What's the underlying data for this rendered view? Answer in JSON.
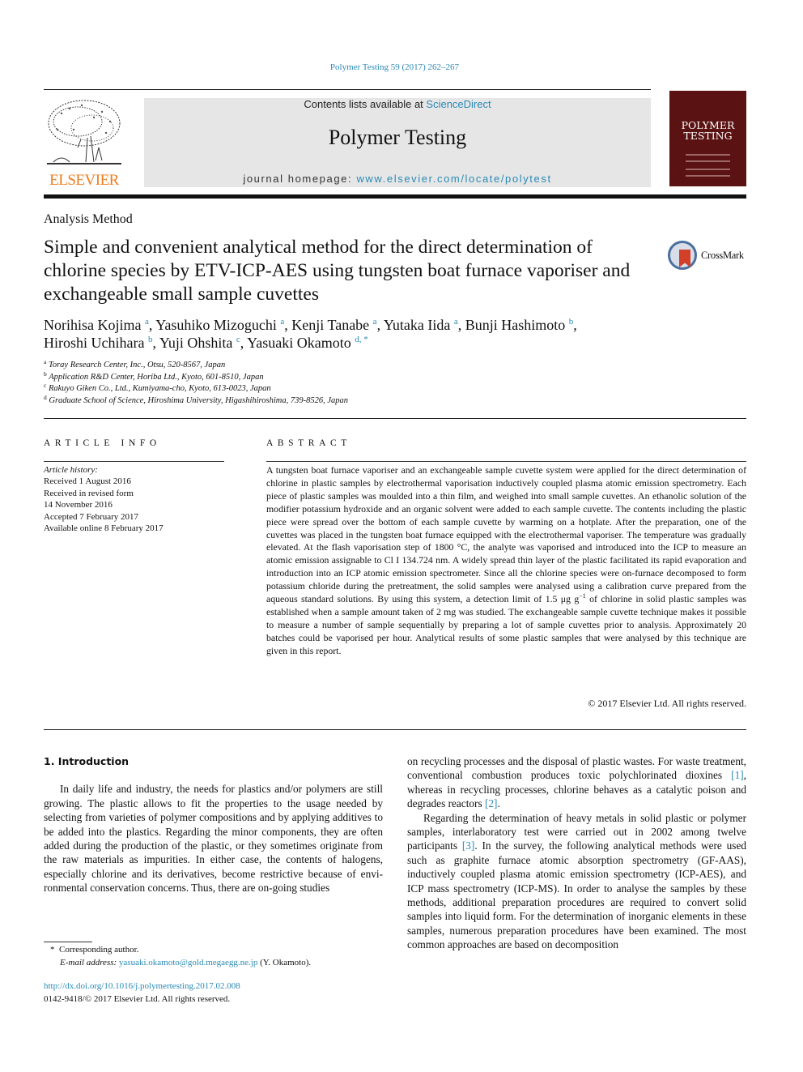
{
  "header": {
    "journal_ref": "Polymer Testing 59 (2017) 262–267",
    "publisher_logo_text": "ELSEVIER",
    "contents_prefix": "Contents lists available at ",
    "contents_link": "ScienceDirect",
    "journal_title": "Polymer Testing",
    "homepage_prefix": "journal homepage: ",
    "homepage_link": "www.elsevier.com/locate/polytest",
    "cover_title_line1": "POLYMER",
    "cover_title_line2": "TESTING"
  },
  "article": {
    "section": "Analysis Method",
    "title": "Simple and convenient analytical method for the direct determination of chlorine species by ETV-ICP-AES using tungsten boat furnace vaporiser and exchangeable small sample cuvettes",
    "crossmark_label": "CrossMark",
    "authors": [
      {
        "name": "Norihisa Kojima",
        "aff": "a",
        "sep": ", "
      },
      {
        "name": "Yasuhiko Mizoguchi",
        "aff": "a",
        "sep": ", "
      },
      {
        "name": "Kenji Tanabe",
        "aff": "a",
        "sep": ", "
      },
      {
        "name": "Yutaka Iida",
        "aff": "a",
        "sep": ", "
      },
      {
        "name": "Bunji Hashimoto",
        "aff": "b",
        "sep": ","
      },
      {
        "name": "Hiroshi Uchihara",
        "aff": "b",
        "sep": ", "
      },
      {
        "name": "Yuji Ohshita",
        "aff": "c",
        "sep": ", "
      },
      {
        "name": "Yasuaki Okamoto",
        "aff": "d, *",
        "sep": ""
      }
    ],
    "affiliations": [
      {
        "key": "a",
        "text": "Toray Research Center, Inc., Otsu, 520-8567, Japan"
      },
      {
        "key": "b",
        "text": "Application R&D Center, Horiba Ltd., Kyoto, 601-8510, Japan"
      },
      {
        "key": "c",
        "text": "Rakuyo Giken Co., Ltd., Kumiyama-cho, Kyoto, 613-0023, Japan"
      },
      {
        "key": "d",
        "text": "Graduate School of Science, Hiroshima University, Higashihiroshima, 739-8526, Japan"
      }
    ]
  },
  "article_info": {
    "heading": "ARTICLE INFO",
    "history_label": "Article history:",
    "history": [
      "Received 1 August 2016",
      "Received in revised form",
      "14 November 2016",
      "Accepted 7 February 2017",
      "Available online 8 February 2017"
    ]
  },
  "abstract": {
    "heading": "ABSTRACT",
    "text_part1": "A tungsten boat furnace vaporiser and an exchangeable sample cuvette system were applied for the direct determination of chlorine in plastic samples by electrothermal vaporisation inductively coupled plasma atomic emission spectrometry. Each piece of plastic samples was moulded into a thin film, and weighed into small sample cuvettes. An ethanolic solution of the modifier potassium hydroxide and an organic solvent were added to each sample cuvette. The contents including the plastic piece were spread over the bottom of each sample cuvette by warming on a hotplate. After the preparation, one of the cuvettes was placed in the tungsten boat furnace equipped with the electrothermal vaporiser. The temperature was gradually elevated. At the flash vaporisation step of 1800 °C, the analyte was vaporised and introduced into the ICP to measure an atomic emission assignable to Cl I 134.724 nm. A widely spread thin layer of the plastic facilitated its rapid evaporation and introduction into an ICP atomic emission spectrometer. Since all the chlorine species were on-furnace decomposed to form potassium chloride during the pretreatment, the solid samples were analysed using a calibration curve prepared from the aqueous standard solutions. By using this system, a detection limit of 1.5 μg g",
    "text_sup": "−1",
    "text_part2": " of chlorine in solid plastic samples was established when a sample amount taken of 2 mg was studied. The exchangeable sample cuvette technique makes it possible to measure a number of sample sequentially by preparing a lot of sample cuvettes prior to analysis. Approximately 20 batches could be vaporised per hour. Analytical results of some plastic samples that were analysed by this technique are given in this report.",
    "copyright": "© 2017 Elsevier Ltd. All rights reserved."
  },
  "body": {
    "section_heading": "1.  Introduction",
    "left_para": "In daily life and industry, the needs for plastics and/or polymers are still growing. The plastic allows to fit the properties to the usage needed by selecting from varieties of polymer compositions and by applying additives to be added into the plastics. Regarding the minor components, they are often added during the production of the plastic, or they sometimes originate from the raw materials as impurities. In either case, the contents of halogens, especially chlorine and its derivatives, become restrictive because of envi­ronmental conservation concerns. Thus, there are on-going studies",
    "right_para1_a": "on recycling processes and the disposal of plastic wastes. For waste treatment, conventional combustion produces toxic poly­chlorinated dioxines ",
    "ref1": "[1]",
    "right_para1_b": ", whereas in recycling processes, chlorine behaves as a catalytic poison and degrades reactors ",
    "ref2": "[2]",
    "right_para1_c": ".",
    "right_para2_a": "Regarding the determination of heavy metals in solid plastic or polymer samples, interlaboratory test were carried out in 2002 among twelve participants ",
    "ref3": "[3]",
    "right_para2_b": ". In the survey, the following analyt­ical methods were used such as graphite furnace atomic absorption spectrometry (GF-AAS), inductively coupled plasma atomic emis­sion spectrometry (ICP-AES), and ICP mass spectrometry (ICP-MS). In order to analyse the samples by these methods, additional preparation procedures are required to convert solid samples into liquid form. For the determination of inorganic elements in these samples, numerous preparation procedures have been examined. The most common approaches are based on decomposition"
  },
  "footer": {
    "corresponding_marker": "*",
    "corresponding_label": "Corresponding author.",
    "email_label": "E-mail address:",
    "email": "yasuaki.okamoto@gold.megaegg.ne.jp",
    "email_suffix": " (Y. Okamoto).",
    "doi": "http://dx.doi.org/10.1016/j.polymertesting.2017.02.008",
    "issn_line": "0142-9418/© 2017 Elsevier Ltd. All rights reserved."
  }
}
